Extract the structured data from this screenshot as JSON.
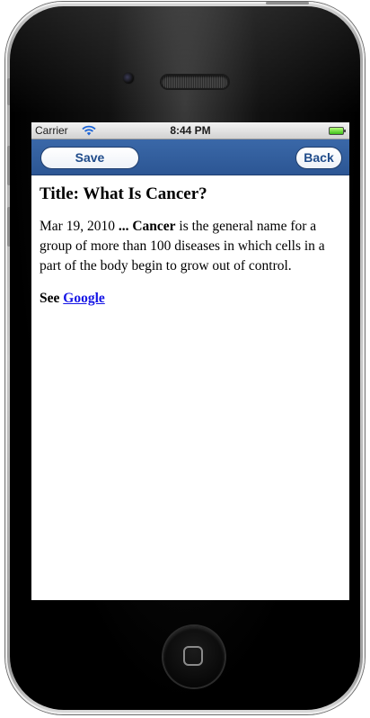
{
  "status_bar": {
    "carrier": "Carrier",
    "time": "8:44 PM",
    "wifi_icon": "wifi-icon",
    "battery_icon": "battery-icon",
    "battery_color": "#3fbf1a"
  },
  "nav_bar": {
    "save_label": "Save",
    "back_label": "Back",
    "color": "#2c5694"
  },
  "article": {
    "title": "Title: What Is Cancer?",
    "date": "Mar 19, 2010",
    "ellipsis": "...",
    "keyword": "Cancer",
    "text": "is the general name for a group of more than 100 diseases in which cells in a part of the body begin to grow out of control.",
    "see_label": "See",
    "link_text": "Google",
    "link_color": "#1515e6"
  },
  "device": {
    "home_icon": "home-button-icon",
    "speaker": "speaker-grille",
    "camera": "front-camera"
  }
}
